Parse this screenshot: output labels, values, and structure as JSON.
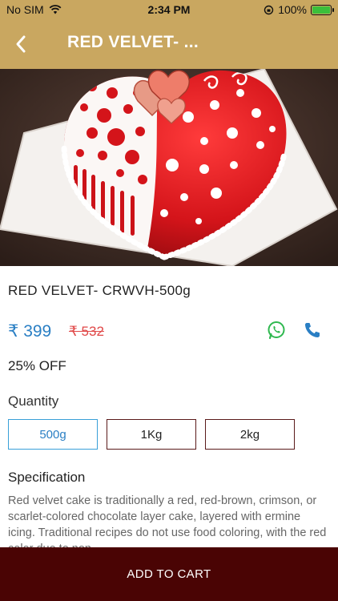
{
  "status_bar": {
    "carrier": "No SIM",
    "time": "2:34 PM",
    "battery": "100%",
    "battery_level": 1.0
  },
  "app_bar": {
    "title": "RED VELVET- ...",
    "back_icon": "chevron-left-icon"
  },
  "product": {
    "name": "RED VELVET- CRWVH-500g",
    "price": "₹ 399",
    "mrp": "₹ 532",
    "discount": "25% OFF",
    "image": "heart-shaped-red-velvet-cake"
  },
  "actions": {
    "whatsapp_icon": "whatsapp-icon",
    "call_icon": "phone-icon",
    "whatsapp_color": "#2fb84f",
    "call_color": "#2a7fc4"
  },
  "quantity": {
    "label": "Quantity",
    "options": [
      "500g",
      "1Kg",
      "2kg"
    ],
    "selected": "500g"
  },
  "specification": {
    "title": "Specification",
    "text": "Red velvet cake is traditionally a red, red-brown, crimson, or scarlet-colored chocolate layer cake, layered with ermine icing. Traditional recipes do not use food coloring, with the red color due to non-"
  },
  "cart": {
    "label": "ADD TO CART"
  },
  "colors": {
    "header": "#c9a760",
    "cart_button": "#4a0404",
    "accent": "#2a7fc4",
    "strike_price": "#e04848"
  }
}
